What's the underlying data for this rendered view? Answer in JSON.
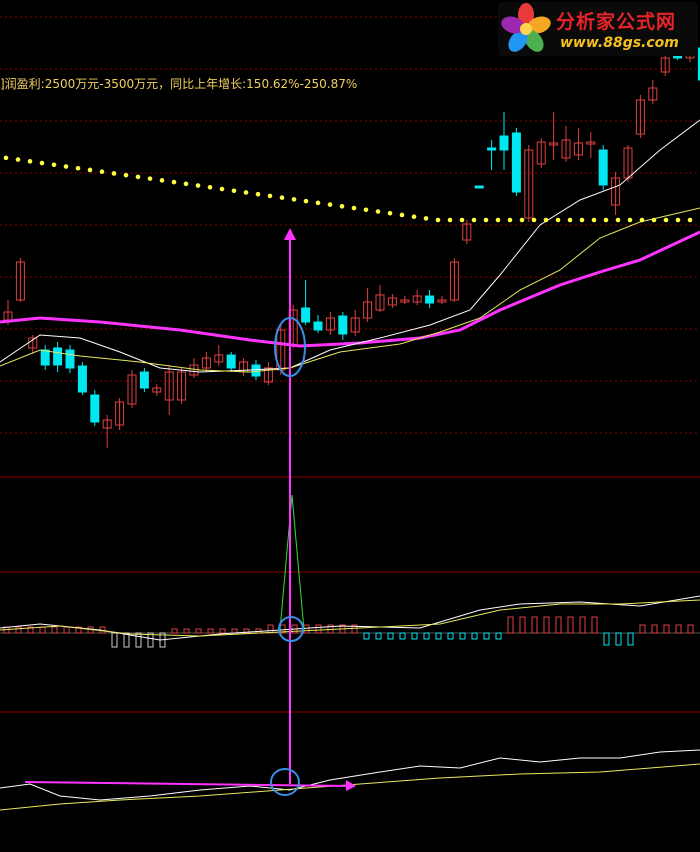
{
  "annotation": {
    "text": "]润盈利:2500万元-3500万元，同比上年增长:150.62%-250.87%"
  },
  "logo": {
    "name_cn": "分析家公式网",
    "url": "www.88gs.com"
  },
  "colors": {
    "background": "#000000",
    "up_candle": "#e04040",
    "down_candle": "#00e8f0",
    "ma_long": "#ff33ff",
    "ma_white": "#ffffff",
    "ma_yellow": "#e8e860",
    "dotted_line": "#ffff44",
    "grid": "#8b0000",
    "annotation_arrow": "#ff33ff",
    "highlight_ellipse": "#3a8ee8",
    "spike_green": "#33dd33"
  },
  "chart_data": {
    "type": "candlestick",
    "panels": [
      "price",
      "histogram",
      "indicator"
    ],
    "candles": [
      {
        "o": 312,
        "c": 320,
        "h": 300,
        "l": 325,
        "up": true
      },
      {
        "o": 300,
        "c": 262,
        "h": 258,
        "l": 302,
        "up": true
      },
      {
        "o": 338,
        "c": 348,
        "h": 335,
        "l": 354,
        "up": true
      },
      {
        "o": 365,
        "c": 350,
        "h": 345,
        "l": 370,
        "up": false
      },
      {
        "o": 365,
        "c": 348,
        "h": 342,
        "l": 372,
        "up": false
      },
      {
        "o": 350,
        "c": 368,
        "h": 345,
        "l": 373,
        "up": false
      },
      {
        "o": 366,
        "c": 392,
        "h": 362,
        "l": 395,
        "up": false
      },
      {
        "o": 395,
        "c": 422,
        "h": 390,
        "l": 426,
        "up": false
      },
      {
        "o": 428,
        "c": 420,
        "h": 415,
        "l": 448,
        "up": true
      },
      {
        "o": 425,
        "c": 402,
        "h": 398,
        "l": 430,
        "up": true
      },
      {
        "o": 404,
        "c": 375,
        "h": 370,
        "l": 408,
        "up": true
      },
      {
        "o": 372,
        "c": 388,
        "h": 368,
        "l": 392,
        "up": false
      },
      {
        "o": 392,
        "c": 388,
        "h": 384,
        "l": 396,
        "up": true
      },
      {
        "o": 400,
        "c": 372,
        "h": 365,
        "l": 415,
        "up": true
      },
      {
        "o": 400,
        "c": 372,
        "h": 368,
        "l": 404,
        "up": true
      },
      {
        "o": 375,
        "c": 365,
        "h": 358,
        "l": 378,
        "up": true
      },
      {
        "o": 368,
        "c": 358,
        "h": 352,
        "l": 372,
        "up": true
      },
      {
        "o": 362,
        "c": 355,
        "h": 345,
        "l": 366,
        "up": true
      },
      {
        "o": 355,
        "c": 368,
        "h": 352,
        "l": 372,
        "up": false
      },
      {
        "o": 372,
        "c": 362,
        "h": 358,
        "l": 376,
        "up": true
      },
      {
        "o": 365,
        "c": 376,
        "h": 360,
        "l": 380,
        "up": false
      },
      {
        "o": 382,
        "c": 368,
        "h": 362,
        "l": 385,
        "up": true
      },
      {
        "o": 370,
        "c": 330,
        "h": 325,
        "l": 375,
        "up": true
      },
      {
        "o": 345,
        "c": 310,
        "h": 305,
        "l": 348,
        "up": true
      },
      {
        "o": 308,
        "c": 322,
        "h": 280,
        "l": 325,
        "up": false
      },
      {
        "o": 322,
        "c": 330,
        "h": 315,
        "l": 333,
        "up": false
      },
      {
        "o": 330,
        "c": 318,
        "h": 312,
        "l": 335,
        "up": true
      },
      {
        "o": 316,
        "c": 334,
        "h": 312,
        "l": 340,
        "up": false
      },
      {
        "o": 332,
        "c": 318,
        "h": 310,
        "l": 336,
        "up": true
      },
      {
        "o": 318,
        "c": 302,
        "h": 288,
        "l": 322,
        "up": true
      },
      {
        "o": 310,
        "c": 295,
        "h": 285,
        "l": 312,
        "up": true
      },
      {
        "o": 305,
        "c": 298,
        "h": 294,
        "l": 308,
        "up": true
      },
      {
        "o": 300,
        "c": 300,
        "h": 296,
        "l": 304,
        "up": true
      },
      {
        "o": 302,
        "c": 296,
        "h": 290,
        "l": 305,
        "up": true
      },
      {
        "o": 296,
        "c": 303,
        "h": 290,
        "l": 308,
        "up": false
      },
      {
        "o": 300,
        "c": 300,
        "h": 296,
        "l": 304,
        "up": true
      },
      {
        "o": 300,
        "c": 262,
        "h": 258,
        "l": 302,
        "up": true
      },
      {
        "o": 240,
        "c": 224,
        "h": 220,
        "l": 244,
        "up": true
      },
      {
        "o": 186,
        "c": 186,
        "h": 186,
        "l": 186,
        "up": false
      },
      {
        "o": 148,
        "c": 148,
        "h": 140,
        "l": 170,
        "up": false
      },
      {
        "o": 136,
        "c": 150,
        "h": 112,
        "l": 170,
        "up": false
      },
      {
        "o": 133,
        "c": 192,
        "h": 128,
        "l": 196,
        "up": false
      },
      {
        "o": 218,
        "c": 150,
        "h": 145,
        "l": 222,
        "up": true
      },
      {
        "o": 164,
        "c": 142,
        "h": 138,
        "l": 168,
        "up": true
      },
      {
        "o": 143,
        "c": 143,
        "h": 112,
        "l": 160,
        "up": true
      },
      {
        "o": 158,
        "c": 140,
        "h": 126,
        "l": 162,
        "up": true
      },
      {
        "o": 155,
        "c": 143,
        "h": 128,
        "l": 160,
        "up": true
      },
      {
        "o": 142,
        "c": 142,
        "h": 132,
        "l": 158,
        "up": true
      },
      {
        "o": 150,
        "c": 185,
        "h": 145,
        "l": 190,
        "up": false
      },
      {
        "o": 205,
        "c": 178,
        "h": 172,
        "l": 215,
        "up": true
      },
      {
        "o": 178,
        "c": 148,
        "h": 145,
        "l": 182,
        "up": true
      },
      {
        "o": 134,
        "c": 100,
        "h": 95,
        "l": 138,
        "up": true
      },
      {
        "o": 100,
        "c": 88,
        "h": 80,
        "l": 104,
        "up": true
      },
      {
        "o": 72,
        "c": 58,
        "h": 50,
        "l": 76,
        "up": true
      },
      {
        "o": 56,
        "c": 58,
        "h": 40,
        "l": 60,
        "up": false
      },
      {
        "o": 58,
        "c": 48,
        "h": 40,
        "l": 62,
        "up": true
      },
      {
        "o": 48,
        "c": 80,
        "h": 40,
        "l": 84,
        "up": false
      }
    ]
  }
}
